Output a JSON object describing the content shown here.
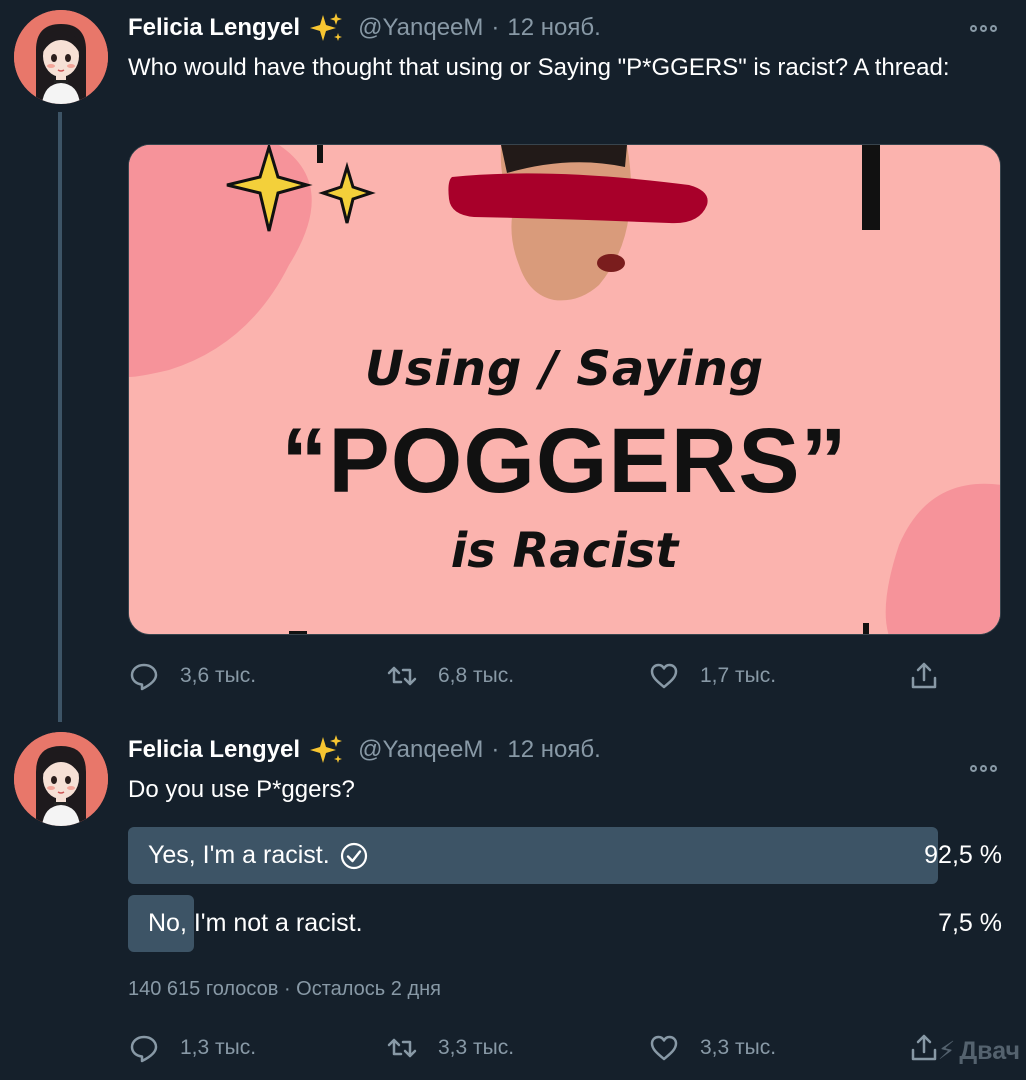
{
  "tweets": [
    {
      "author_name": "Felicia Lengyel",
      "author_emoji": "sparkles-icon",
      "handle": "@YanqeeM",
      "separator": "·",
      "date": "12 нояб.",
      "text": "Who would have thought that using or Saying \"P*GGERS\" is racist? A thread:",
      "media": {
        "line1": "Using / Saying",
        "line2": "“POGGERS”",
        "line3": "is Racist"
      },
      "actions": {
        "reply": "3,6 тыс.",
        "retweet": "6,8 тыс.",
        "like": "1,7 тыс."
      }
    },
    {
      "author_name": "Felicia Lengyel",
      "author_emoji": "sparkles-icon",
      "handle": "@YanqeeM",
      "separator": "·",
      "date": "12 нояб.",
      "text": "Do you use P*ggers?",
      "poll": {
        "options": [
          {
            "label": "Yes, I'm a racist.",
            "percent_text": "92,5 %",
            "percent": 92.5,
            "selected": true
          },
          {
            "label": "No, I'm not a racist.",
            "percent_text": "7,5 %",
            "percent": 7.5,
            "selected": false
          }
        ],
        "meta": "140 615 голосов · Осталось 2 дня"
      },
      "actions": {
        "reply": "1,3 тыс.",
        "retweet": "3,3 тыс.",
        "like": "3,3 тыс."
      }
    }
  ],
  "watermark": "Двач",
  "colors": {
    "background": "#15202b",
    "muted": "#8899a6",
    "poll_bar": "#3d5466",
    "thread_line": "#3d5466"
  }
}
